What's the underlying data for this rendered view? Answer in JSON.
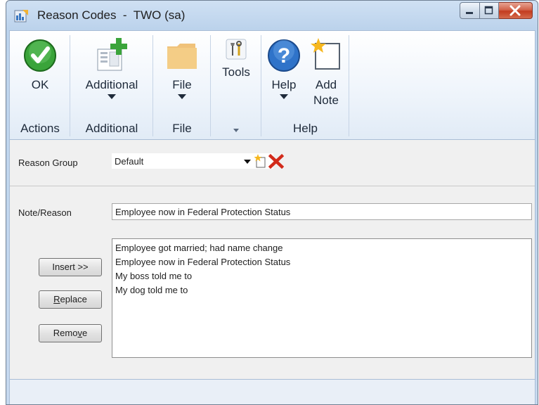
{
  "window": {
    "title": "Reason Codes  -  TWO (sa)"
  },
  "ribbon": {
    "groups": [
      {
        "label": "Actions",
        "buttons": [
          {
            "label": "OK",
            "icon": "check-icon"
          }
        ]
      },
      {
        "label": "Additional",
        "buttons": [
          {
            "label": "Additional",
            "icon": "additional-icon"
          }
        ]
      },
      {
        "label": "File",
        "buttons": [
          {
            "label": "File",
            "icon": "folder-icon"
          }
        ]
      },
      {
        "label": "",
        "buttons": [
          {
            "label": "Tools",
            "icon": "tools-icon"
          }
        ]
      },
      {
        "label": "Help",
        "buttons": [
          {
            "label": "Help",
            "icon": "help-icon"
          },
          {
            "label_line1": "Add",
            "label_line2": "Note",
            "icon": "add-note-icon"
          }
        ]
      }
    ]
  },
  "form": {
    "reason_group_label": "Reason Group",
    "reason_group_value": "Default",
    "note_reason_label": "Note/Reason",
    "note_reason_value": "Employee now in Federal Protection Status",
    "buttons": {
      "insert": "Insert >>",
      "replace_first": "R",
      "replace_rest": "eplace",
      "remove_first": "Remo",
      "remove_u": "v",
      "remove_rest": "e"
    },
    "reasons": [
      "Employee got married; had name change",
      "Employee now in Federal Protection Status",
      "My boss told me to",
      "My dog told me to"
    ]
  },
  "colors": {
    "accent": "#2f73c9",
    "ok_green": "#3aa43a",
    "delete_red": "#d22a1a"
  }
}
